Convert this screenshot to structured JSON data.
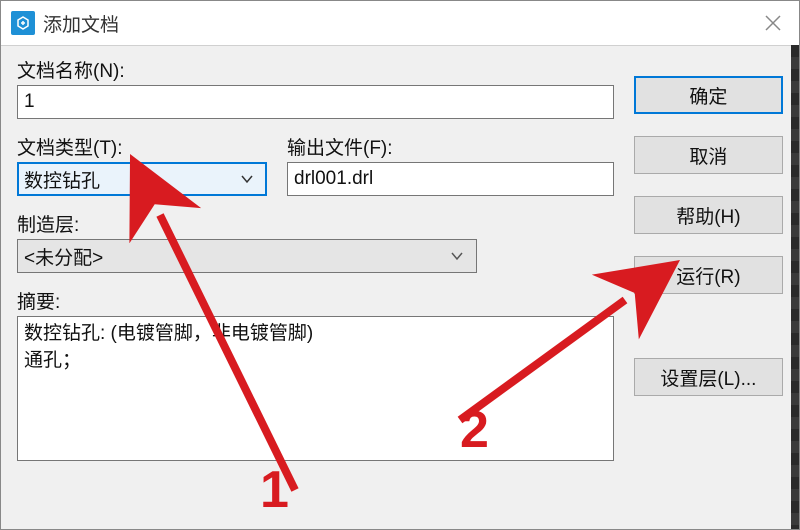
{
  "window": {
    "title": "添加文档"
  },
  "labels": {
    "doc_name": "文档名称(N):",
    "doc_type": "文档类型(T):",
    "output_file": "输出文件(F):",
    "mfg_layer": "制造层:",
    "summary": "摘要:"
  },
  "fields": {
    "doc_name": "1",
    "doc_type": "数控钻孔",
    "output_file": "drl001.drl",
    "mfg_layer": "<未分配>",
    "summary_line1": "数控钻孔: (电镀管脚，非电镀管脚)",
    "summary_line2": "通孔；"
  },
  "buttons": {
    "ok": "确定",
    "cancel": "取消",
    "help": "帮助(H)",
    "run": "运行(R)",
    "set_layer": "设置层(L)..."
  },
  "annotations": {
    "one": "1",
    "two": "2"
  }
}
